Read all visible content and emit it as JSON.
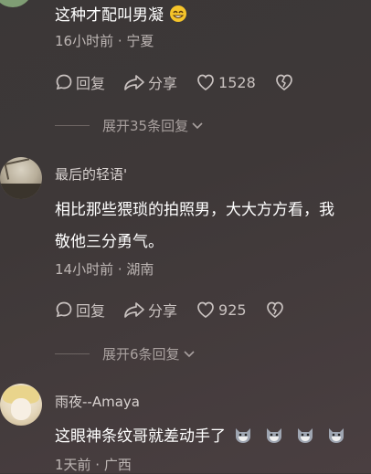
{
  "comments": [
    {
      "text": "这种才配叫男凝",
      "meta": "16小时前 · 宁夏",
      "reply": "回复",
      "share": "分享",
      "likes": "1528",
      "expand": "展开35条回复"
    },
    {
      "username": "最后的轻语'",
      "text_line1": "相比那些猥琐的拍照男，大大方方看，我",
      "text_line2": "敬他三分勇气。",
      "meta": "14小时前 · 湖南",
      "reply": "回复",
      "share": "分享",
      "likes": "925",
      "expand": "展开6条回复"
    },
    {
      "username": "雨夜--Amaya",
      "text": "这眼神条纹哥就差动手了",
      "meta": "1天前 · 广西"
    }
  ],
  "icons": {
    "reply": "comment-bubble-icon",
    "share": "share-arrow-icon",
    "like": "heart-icon",
    "dislike": "broken-heart-icon",
    "expand": "chevron-down-icon"
  }
}
